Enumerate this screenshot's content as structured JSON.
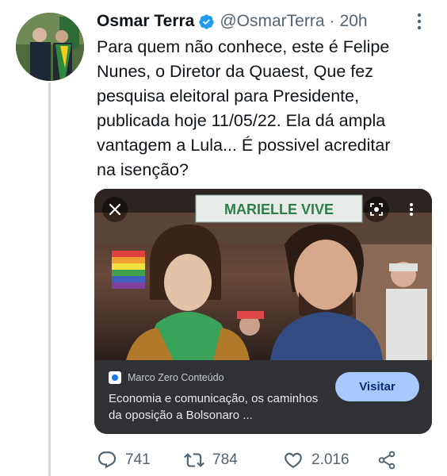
{
  "author": {
    "name": "Osmar Terra",
    "handle": "@OsmarTerra",
    "separator": "·",
    "time": "20h"
  },
  "tweet": {
    "text": "Para quem não conhece, este é Felipe\nNunes, o Diretor da Quaest, Que fez\npesquisa eleitoral para Presidente,\npublicada hoje 11/05/22. Ela dá ampla\nvantagem a Lula... É possivel acreditar\nna isenção?"
  },
  "card": {
    "banner_text": "MARIELLE VIVE",
    "source_name": "Marco Zero Conteúdo",
    "title": "Economia e comunicação, os caminhos da oposição a Bolsonaro ...",
    "visit_label": "Visitar"
  },
  "actions": {
    "replies": "741",
    "retweets": "784",
    "likes": "2.016"
  },
  "icons": {
    "verified": "verified-badge-icon",
    "more": "more-options-icon",
    "close": "close-icon",
    "lens": "lens-search-icon",
    "kebab": "kebab-menu-icon",
    "reply": "reply-icon",
    "retweet": "retweet-icon",
    "like": "heart-icon",
    "share": "share-icon"
  },
  "colors": {
    "verified": "#1d9bf0",
    "secondary_text": "#536471",
    "visit_button": "#a8c7fa",
    "card_info_bg": "#303134"
  }
}
